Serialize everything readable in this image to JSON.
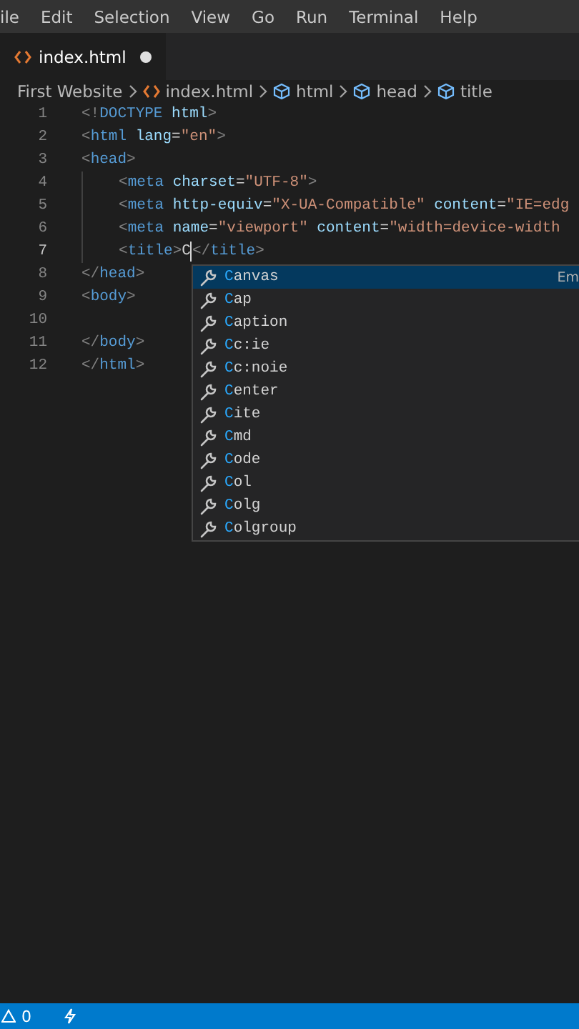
{
  "menu_bar": [
    "ile",
    "Edit",
    "Selection",
    "View",
    "Go",
    "Run",
    "Terminal",
    "Help"
  ],
  "tabs": [
    {
      "label": "index.html",
      "selected": true,
      "modified": true
    }
  ],
  "breadcrumbs": [
    {
      "label": "First Website",
      "kind": "folder"
    },
    {
      "label": "index.html",
      "kind": "file"
    },
    {
      "label": "html",
      "kind": "symbol"
    },
    {
      "label": "head",
      "kind": "symbol"
    },
    {
      "label": "title",
      "kind": "symbol"
    }
  ],
  "lines": [
    {
      "number": "1",
      "active": false,
      "indented": false,
      "tokens": [
        {
          "kind": "punct",
          "text": "<!"
        },
        {
          "kind": "tag",
          "text": "DOCTYPE"
        },
        {
          "kind": "attr",
          "text": " html"
        },
        {
          "kind": "punct",
          "text": ">"
        }
      ]
    },
    {
      "number": "2",
      "active": false,
      "indented": false,
      "tokens": [
        {
          "kind": "punct",
          "text": "<"
        },
        {
          "kind": "tag",
          "text": "html"
        },
        {
          "kind": "attr",
          "text": " lang"
        },
        {
          "kind": "text",
          "text": "="
        },
        {
          "kind": "string",
          "text": "\"en\""
        },
        {
          "kind": "punct",
          "text": ">"
        }
      ]
    },
    {
      "number": "3",
      "active": false,
      "indented": false,
      "tokens": [
        {
          "kind": "punct",
          "text": "<"
        },
        {
          "kind": "tag",
          "text": "head"
        },
        {
          "kind": "punct",
          "text": ">"
        }
      ]
    },
    {
      "number": "4",
      "active": false,
      "indented": true,
      "tokens": [
        {
          "kind": "punct",
          "text": "<"
        },
        {
          "kind": "tag",
          "text": "meta"
        },
        {
          "kind": "attr",
          "text": " charset"
        },
        {
          "kind": "text",
          "text": "="
        },
        {
          "kind": "string",
          "text": "\"UTF-8\""
        },
        {
          "kind": "punct",
          "text": ">"
        }
      ]
    },
    {
      "number": "5",
      "active": false,
      "indented": true,
      "tokens": [
        {
          "kind": "punct",
          "text": "<"
        },
        {
          "kind": "tag",
          "text": "meta"
        },
        {
          "kind": "attr",
          "text": " http-equiv"
        },
        {
          "kind": "text",
          "text": "="
        },
        {
          "kind": "string",
          "text": "\"X-UA-Compatible\""
        },
        {
          "kind": "attr",
          "text": " content"
        },
        {
          "kind": "text",
          "text": "="
        },
        {
          "kind": "string",
          "text": "\"IE=edg"
        }
      ]
    },
    {
      "number": "6",
      "active": false,
      "indented": true,
      "tokens": [
        {
          "kind": "punct",
          "text": "<"
        },
        {
          "kind": "tag",
          "text": "meta"
        },
        {
          "kind": "attr",
          "text": " name"
        },
        {
          "kind": "text",
          "text": "="
        },
        {
          "kind": "string",
          "text": "\"viewport\""
        },
        {
          "kind": "attr",
          "text": " content"
        },
        {
          "kind": "text",
          "text": "="
        },
        {
          "kind": "string",
          "text": "\"width=device-width"
        }
      ]
    },
    {
      "number": "7",
      "active": true,
      "indented": true,
      "tokens": [
        {
          "kind": "punct",
          "text": "<"
        },
        {
          "kind": "tag",
          "text": "title"
        },
        {
          "kind": "punct",
          "text": ">"
        },
        {
          "kind": "text",
          "text": "C"
        },
        {
          "kind": "cursor"
        },
        {
          "kind": "punct",
          "text": "</"
        },
        {
          "kind": "tag",
          "text": "title"
        },
        {
          "kind": "punct",
          "text": ">"
        }
      ]
    },
    {
      "number": "8",
      "active": false,
      "indented": false,
      "tokens": [
        {
          "kind": "punct",
          "text": "</"
        },
        {
          "kind": "tag",
          "text": "head"
        },
        {
          "kind": "punct",
          "text": ">"
        }
      ]
    },
    {
      "number": "9",
      "active": false,
      "indented": false,
      "tokens": [
        {
          "kind": "punct",
          "text": "<"
        },
        {
          "kind": "tag",
          "text": "body"
        },
        {
          "kind": "punct",
          "text": ">"
        }
      ]
    },
    {
      "number": "10",
      "active": false,
      "indented": false
    },
    {
      "number": "11",
      "active": false,
      "indented": false,
      "tokens": [
        {
          "kind": "punct",
          "text": "</"
        },
        {
          "kind": "tag",
          "text": "body"
        },
        {
          "kind": "punct",
          "text": ">"
        }
      ]
    },
    {
      "number": "12",
      "active": false,
      "indented": false,
      "tokens": [
        {
          "kind": "punct",
          "text": "</"
        },
        {
          "kind": "tag",
          "text": "html"
        },
        {
          "kind": "punct",
          "text": ">"
        }
      ]
    }
  ],
  "suggestions": [
    {
      "match": "C",
      "rest": "anvas",
      "selected": true,
      "detail": "Em"
    },
    {
      "match": "C",
      "rest": "ap",
      "selected": false
    },
    {
      "match": "C",
      "rest": "aption",
      "selected": false
    },
    {
      "match": "C",
      "rest": "c:ie",
      "selected": false
    },
    {
      "match": "C",
      "rest": "c:noie",
      "selected": false
    },
    {
      "match": "C",
      "rest": "enter",
      "selected": false
    },
    {
      "match": "C",
      "rest": "ite",
      "selected": false
    },
    {
      "match": "C",
      "rest": "md",
      "selected": false
    },
    {
      "match": "C",
      "rest": "ode",
      "selected": false
    },
    {
      "match": "C",
      "rest": "ol",
      "selected": false
    },
    {
      "match": "C",
      "rest": "olg",
      "selected": false
    },
    {
      "match": "C",
      "rest": "olgroup",
      "selected": false
    }
  ],
  "status_bar": {
    "warnings": "0"
  }
}
